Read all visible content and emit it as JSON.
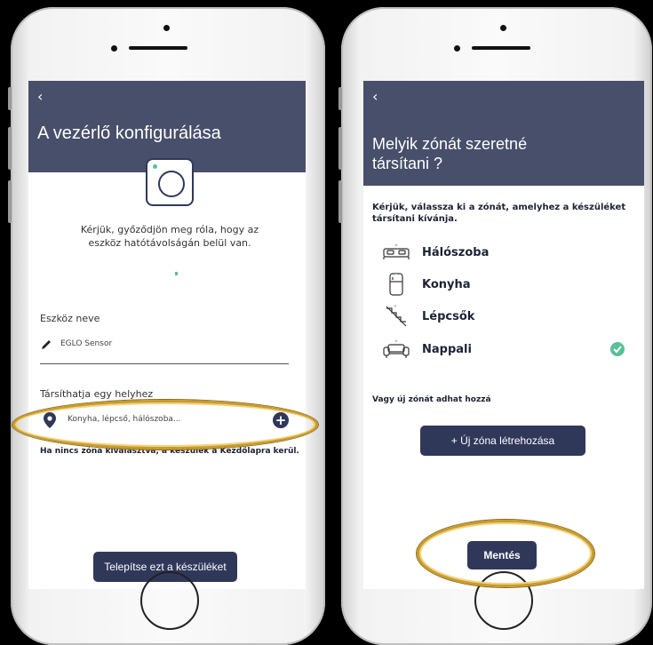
{
  "left_screen": {
    "back_icon": "‹",
    "title": "A vezérlő konfigurálása",
    "instruction": "Kérjük, győződjön meg róla, hogy az eszköz hatótávolságán belül van.",
    "device_name_label": "Eszköz neve",
    "device_name_value": "EGLO Sensor",
    "location_label": "Társíthatja egy helyhez",
    "location_placeholder": "Konyha, lépcső, hálószoba...",
    "hint_text": "Ha nincs zóna kiválasztva, a készülék a Kezdőlapra kerül.",
    "install_button": "Telepítse ezt a készüléket"
  },
  "right_screen": {
    "back_icon": "‹",
    "title_line1": "Melyik zónát szeretné",
    "title_line2": "társítani ?",
    "instruction": "Kérjük, válassza ki a zónát, amelyhez a készüléket társítani kívánja.",
    "zones": [
      {
        "label": "Hálószoba",
        "icon": "bed-icon",
        "selected": false
      },
      {
        "label": "Konyha",
        "icon": "fridge-icon",
        "selected": false
      },
      {
        "label": "Lépcsők",
        "icon": "stairs-icon",
        "selected": false
      },
      {
        "label": "Nappali",
        "icon": "sofa-icon",
        "selected": true
      }
    ],
    "new_zone_hint": "Vagy új zónát adhat hozzá",
    "new_zone_button": "+ Új zóna létrehozása",
    "save_button": "Mentés"
  },
  "colors": {
    "header": "#474f6a",
    "button": "#30385a",
    "check": "#5bbf9a",
    "highlight_oval": "#c89b2e"
  }
}
